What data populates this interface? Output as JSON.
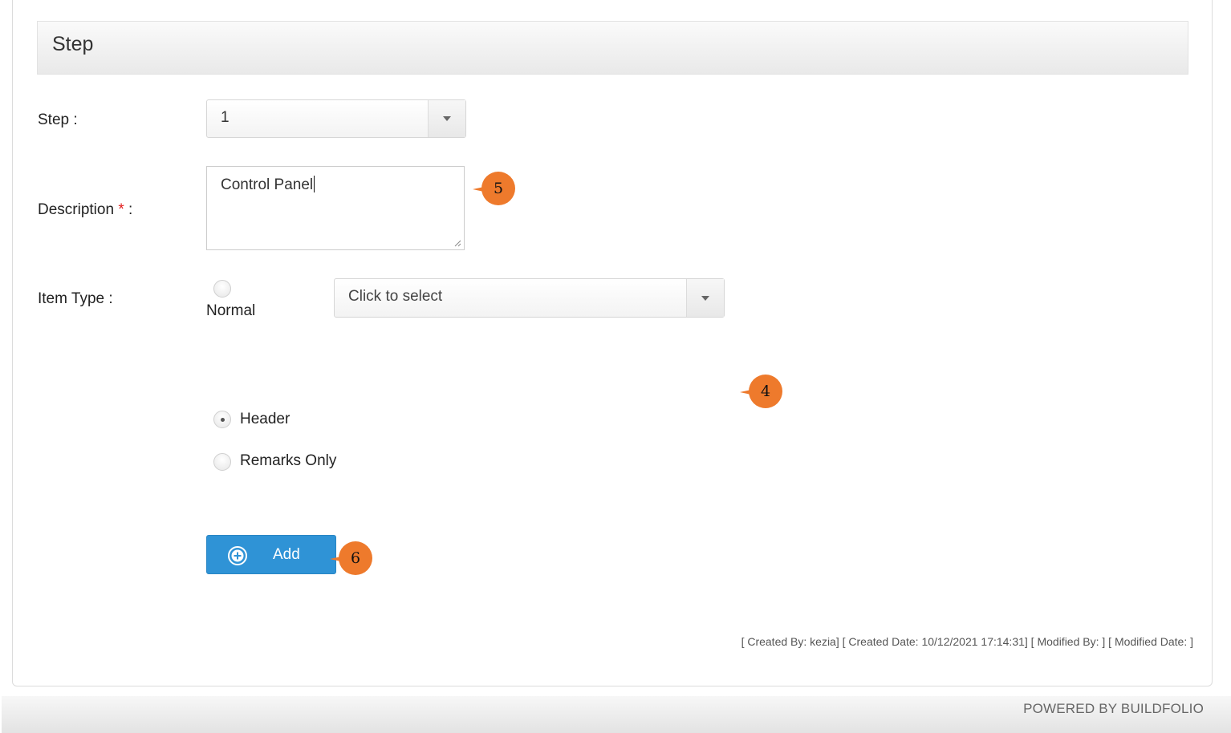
{
  "section": {
    "title": "Step"
  },
  "step_field": {
    "label": "Step :",
    "value": "1"
  },
  "description_field": {
    "label": "Description",
    "required_marker": "*",
    "label_suffix": " :",
    "value": "Control Panel"
  },
  "item_type_field": {
    "label": "Item Type :",
    "options": [
      {
        "label": "Normal",
        "checked": false
      },
      {
        "label": "Header",
        "checked": true
      },
      {
        "label": "Remarks Only",
        "checked": false
      }
    ],
    "select_placeholder": "Click to select"
  },
  "callouts": [
    "5",
    "4",
    "6"
  ],
  "actions": {
    "add_label": "Add"
  },
  "audit": "[ Created By: kezia] [ Created Date: 10/12/2021 17:14:31] [ Modified By: ] [ Modified Date: ]",
  "footer": {
    "text": "POWERED BY BUILDFOLIO"
  },
  "colors": {
    "button": "#2f93d6",
    "callout": "#ee7a2c",
    "required": "#e21b1b"
  }
}
